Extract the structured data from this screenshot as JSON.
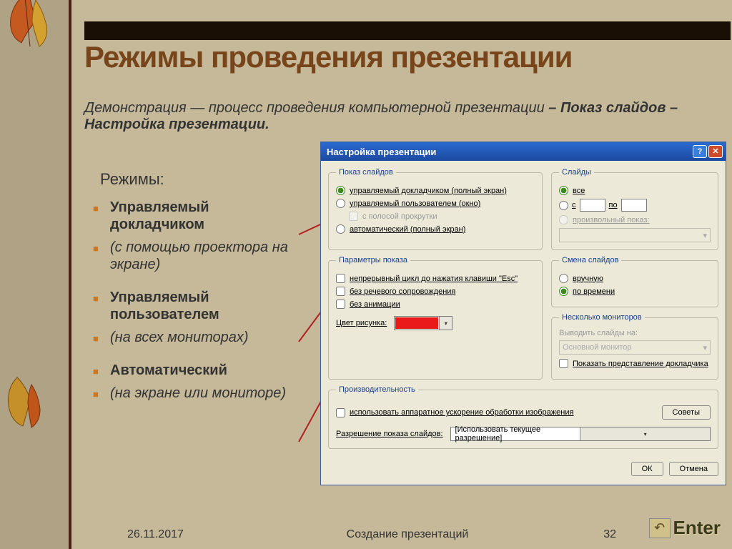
{
  "slide": {
    "title": "Режимы проведения презентации",
    "subtitle_plain": "Демонстрация — процесс проведения компьютерной презентации",
    "subtitle_bold": " – Показ слайдов – Настройка презентации.",
    "modes_label": "Режимы:",
    "bullets": {
      "b1": "Управляемый докладчиком",
      "b2": " (с помощью проектора на экране)",
      "b3": "Управляемый пользователем",
      "b4": "(на всех мониторах)",
      "b5": "Автоматический",
      "b6": "(на экране или мониторе)"
    },
    "footer_date": "26.11.2017",
    "footer_center": "Создание презентаций",
    "footer_num": "32",
    "enter_label": "Enter"
  },
  "dlg": {
    "title": "Настройка презентации",
    "show_group": "Показ слайдов",
    "show_opt1": "управляемый докладчиком (полный экран)",
    "show_opt2": "управляемый пользователем (окно)",
    "show_opt2_scroll": "с полосой прокрутки",
    "show_opt3": "автоматический (полный экран)",
    "slides_group": "Слайды",
    "slides_all": "все",
    "slides_from": "с",
    "slides_to": "по",
    "slides_custom": "произвольный показ:",
    "params_group": "Параметры показа",
    "param_loop": "непрерывный цикл до нажатия клавиши \"Esc\"",
    "param_nonarr": "без речевого сопровождения",
    "param_noanim": "без анимации",
    "pen_color": "Цвет рисунка:",
    "advance_group": "Смена слайдов",
    "adv_manual": "вручную",
    "adv_timing": "по времени",
    "monitors_group": "Несколько мониторов",
    "mon_output": "Выводить слайды на:",
    "mon_primary": "Основной монитор",
    "mon_presenter": "Показать представление докладчика",
    "perf_group": "Производительность",
    "perf_hw": "использовать аппаратное ускорение обработки изображения",
    "perf_tips": "Советы",
    "perf_res_label": "Разрешение показа слайдов:",
    "perf_res_value": "[Использовать текущее разрешение]",
    "ok": "ОК",
    "cancel": "Отмена"
  }
}
